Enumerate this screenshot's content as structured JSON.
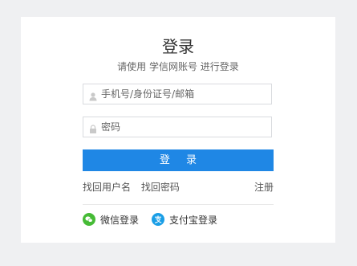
{
  "header": {
    "title": "登录",
    "subtitle": "请使用 学信网账号 进行登录"
  },
  "form": {
    "account_placeholder": "手机号/身份证号/邮箱",
    "password_placeholder": "密码",
    "login_label": "登 录"
  },
  "links": {
    "find_username": "找回用户名",
    "find_password": "找回密码",
    "register": "注册"
  },
  "social": {
    "wechat_label": "微信登录",
    "alipay_label": "支付宝登录"
  },
  "colors": {
    "primary": "#1f87e5",
    "wechat": "#46bb36",
    "alipay": "#1a9ee6"
  }
}
